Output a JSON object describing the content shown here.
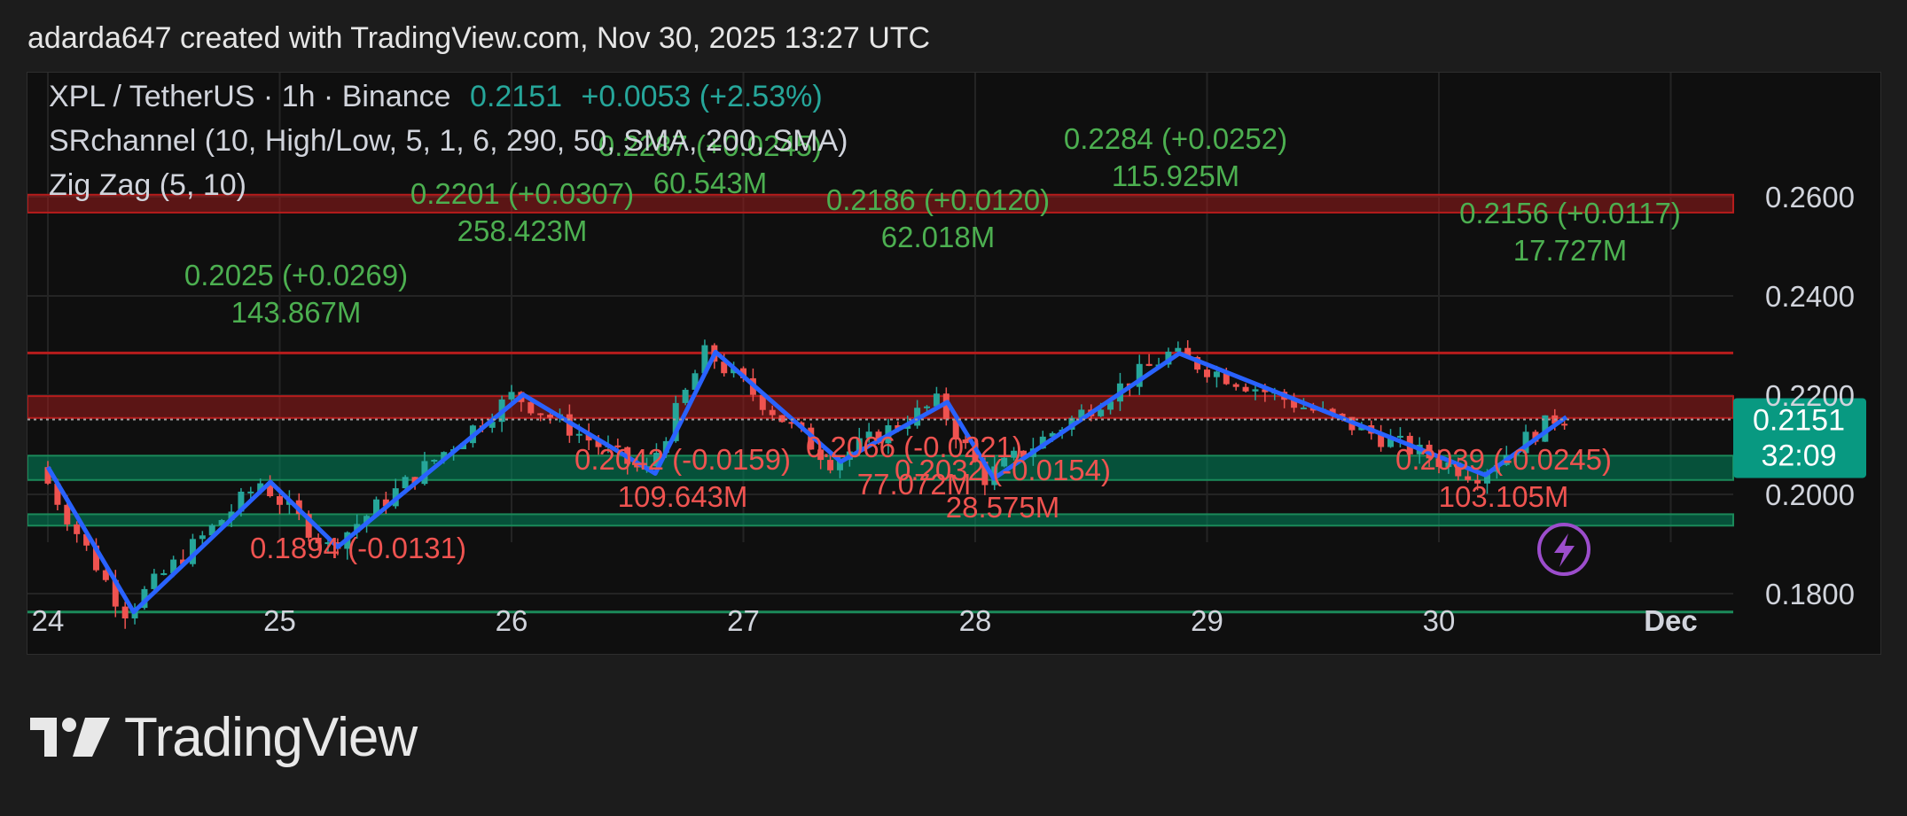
{
  "header": {
    "attribution": "adarda647 created with TradingView.com, Nov 30, 2025 13:27 UTC"
  },
  "legend": {
    "symbol": "XPL / TetherUS · 1h · Binance",
    "last": "0.2151",
    "change": "+0.0053 (+2.53%)",
    "indicator1": "SRchannel (10, High/Low, 5, 1, 6, 290, 50, SMA, 200, SMA)",
    "indicator2": "Zig Zag (5, 10)"
  },
  "price_tag": {
    "price": "0.2151",
    "countdown": "32:09"
  },
  "logo": {
    "text": "TradingView"
  },
  "colors": {
    "up": "#26a69a",
    "down": "#ef5350",
    "zigzag": "#2962ff",
    "label_up": "#4caf50",
    "label_down": "#ef5350",
    "tag": "#089981"
  },
  "chart_data": {
    "type": "candlestick",
    "x_ticks": [
      "24",
      "25",
      "26",
      "27",
      "28",
      "29",
      "30",
      "Dec"
    ],
    "y_ticks": [
      0.18,
      0.2,
      0.22,
      0.24,
      0.26
    ],
    "y_tick_labels": [
      "0.1800",
      "0.2000",
      "0.2200",
      "0.2400",
      "0.2600"
    ],
    "ylim": [
      0.1685,
      0.2665
    ],
    "last_price": 0.2151,
    "zigzag_points": [
      {
        "t": 0.0,
        "p": 0.2055
      },
      {
        "t": 0.37,
        "p": 0.1763
      },
      {
        "t": 0.96,
        "p": 0.2025
      },
      {
        "t": 1.25,
        "p": 0.1894
      },
      {
        "t": 2.05,
        "p": 0.2201
      },
      {
        "t": 2.62,
        "p": 0.2042
      },
      {
        "t": 2.88,
        "p": 0.2287
      },
      {
        "t": 3.42,
        "p": 0.2066
      },
      {
        "t": 3.88,
        "p": 0.2186
      },
      {
        "t": 4.08,
        "p": 0.2032
      },
      {
        "t": 4.88,
        "p": 0.2284
      },
      {
        "t": 6.2,
        "p": 0.2039
      },
      {
        "t": 6.55,
        "p": 0.2156
      }
    ],
    "pivot_labels": [
      {
        "text": "0.1894 (-0.0131)",
        "vol": "",
        "t": 1.25,
        "kind": "low"
      },
      {
        "text": "0.2025 (+0.0269)",
        "vol": "143.867M",
        "t": 0.42,
        "kind": "high"
      },
      {
        "text": "0.2201 (+0.0307)",
        "vol": "258.423M",
        "t": 1.1,
        "kind": "high"
      },
      {
        "text": "0.2287 (+0.0245)",
        "vol": "60.543M",
        "t": 1.97,
        "kind": "high"
      },
      {
        "text": "0.2186 (+0.0120)",
        "vol": "62.018M",
        "t": 2.9,
        "kind": "high"
      },
      {
        "text": "0.2284 (+0.0252)",
        "vol": "115.925M",
        "t": 3.95,
        "kind": "high"
      },
      {
        "text": "0.2156 (+0.0117)",
        "vol": "17.727M",
        "t": 5.52,
        "kind": "high"
      },
      {
        "text": "0.2042 (-0.0159)",
        "vol": "109.643M",
        "t": 1.65,
        "kind": "low"
      },
      {
        "text": "0.2066 (-0.0221)",
        "vol": "77.072M",
        "t": 2.42,
        "kind": "low"
      },
      {
        "text": "0.2032 (-0.0154)",
        "vol": "28.575M",
        "t": 2.95,
        "kind": "low"
      },
      {
        "text": "0.2039 (-0.0245)",
        "vol": "103.105M",
        "t": 5.2,
        "kind": "low"
      }
    ],
    "sr_zones": [
      {
        "low": 0.2568,
        "high": 0.2604,
        "kind": "resistance"
      },
      {
        "low": 0.2154,
        "high": 0.2198,
        "kind": "resistance"
      },
      {
        "low": 0.2029,
        "high": 0.2078,
        "kind": "support"
      },
      {
        "low": 0.1937,
        "high": 0.196,
        "kind": "support"
      }
    ],
    "sr_lines": [
      {
        "price": 0.2285,
        "kind": "resistance"
      },
      {
        "price": 0.1763,
        "kind": "support"
      }
    ]
  }
}
